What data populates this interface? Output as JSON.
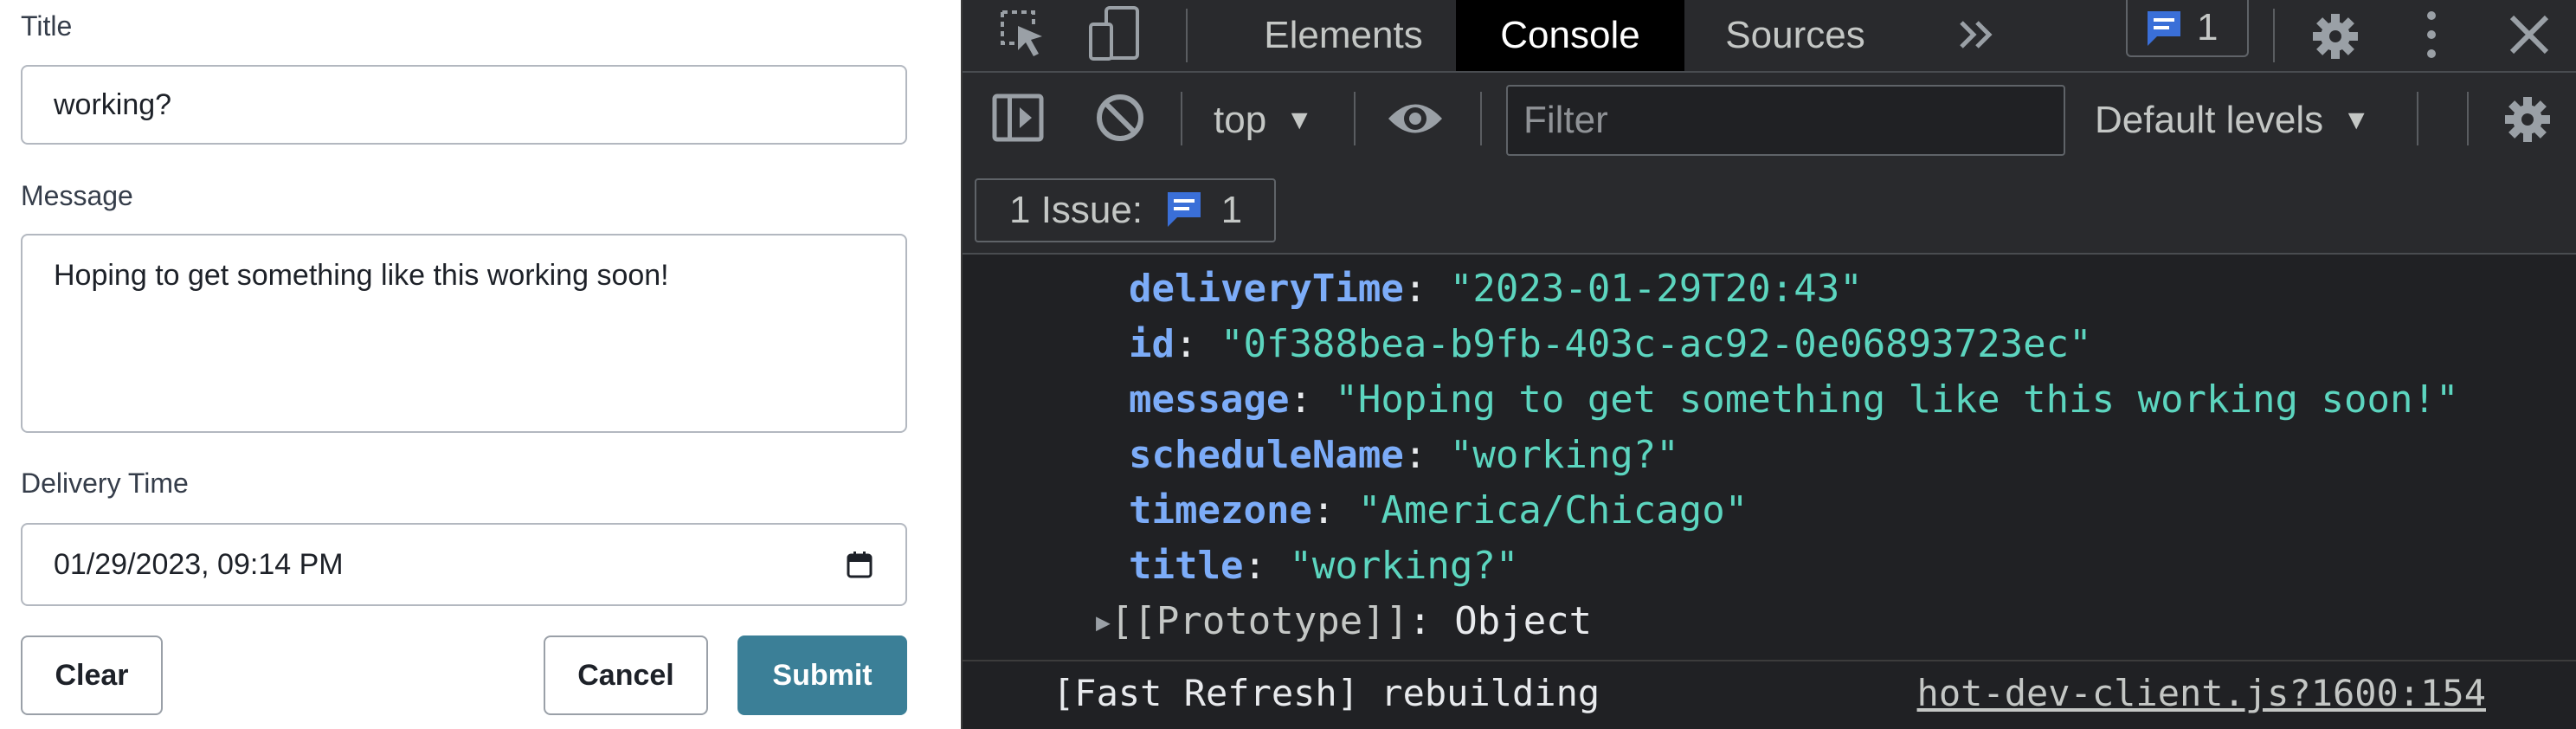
{
  "form": {
    "title_label": "Title",
    "title_value": "working?",
    "message_label": "Message",
    "message_value": "Hoping to get something like this working soon!",
    "delivery_label": "Delivery Time",
    "delivery_value": "01/29/2023, 09:14 PM",
    "clear_label": "Clear",
    "cancel_label": "Cancel",
    "submit_label": "Submit",
    "submit_color": "#3b7f97"
  },
  "devtools": {
    "tabs": [
      "Elements",
      "Console",
      "Sources"
    ],
    "active_tab": "Console",
    "issue_badge_count": "1",
    "context": "top",
    "filter_placeholder": "Filter",
    "levels": "Default levels",
    "issues_label": "1 Issue:",
    "issues_count": "1",
    "icons": [
      "inspect-icon",
      "device-toolbar-icon",
      "more-tabs-icon",
      "issues-icon",
      "settings-icon",
      "kebab-menu-icon",
      "close-icon",
      "sidebar-toggle-icon",
      "clear-console-icon",
      "live-expression-eye-icon"
    ],
    "accent_color": "#3a6fd8"
  },
  "console": {
    "properties": [
      {
        "key": "deliveryTime",
        "value": "\"2023-01-29T20:43\""
      },
      {
        "key": "id",
        "value": "\"0f388bea-b9fb-403c-ac92-0e06893723ec\""
      },
      {
        "key": "message",
        "value": "\"Hoping to get something like this working soon!\""
      },
      {
        "key": "scheduleName",
        "value": "\"working?\""
      },
      {
        "key": "timezone",
        "value": "\"America/Chicago\""
      },
      {
        "key": "title",
        "value": "\"working?\""
      }
    ],
    "prototype_key": "[[Prototype]]",
    "prototype_value": "Object",
    "status_message": "[Fast Refresh] rebuilding",
    "status_source": "hot-dev-client.js?1600:154"
  }
}
